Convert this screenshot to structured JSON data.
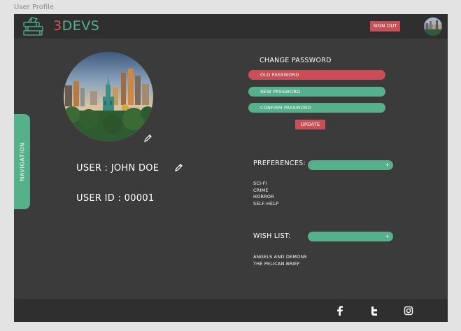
{
  "frame": {
    "title": "User Profile"
  },
  "header": {
    "logo_number": "3",
    "logo_text": "DEVS",
    "signout_label": "SIGN OUT",
    "avatar_icon": "avatar-icon"
  },
  "nav": {
    "label": "NAVIGATION"
  },
  "profile": {
    "user_label": "USER : JOHN DOE",
    "user_id_label": "USER ID : 00001",
    "edit_icon": "pencil-icon"
  },
  "password": {
    "heading": "CHANGE PASSWORD",
    "old_label": "OLD PASSWORD",
    "new_label": "NEW PASSWORD",
    "confirm_label": "CONFIRM PASSWORD",
    "update_label": "UPDATE"
  },
  "preferences": {
    "label": "PREFERENCES:",
    "add_symbol": "+",
    "items": [
      "SCI-FI",
      "CRIME",
      "HORROR",
      "SELF-HELP"
    ]
  },
  "wishlist": {
    "label": "WISH LIST:",
    "add_symbol": "+",
    "items": [
      "ANGELS AND DEMONS",
      "THE PELICAN BRIEF"
    ]
  },
  "footer": {
    "icons": [
      "facebook-icon",
      "twitter-icon",
      "instagram-icon"
    ]
  },
  "colors": {
    "background": "#3c3b3b",
    "bar": "#2f2f2f",
    "accent_green": "#56b08c",
    "accent_red": "#c94f57"
  }
}
